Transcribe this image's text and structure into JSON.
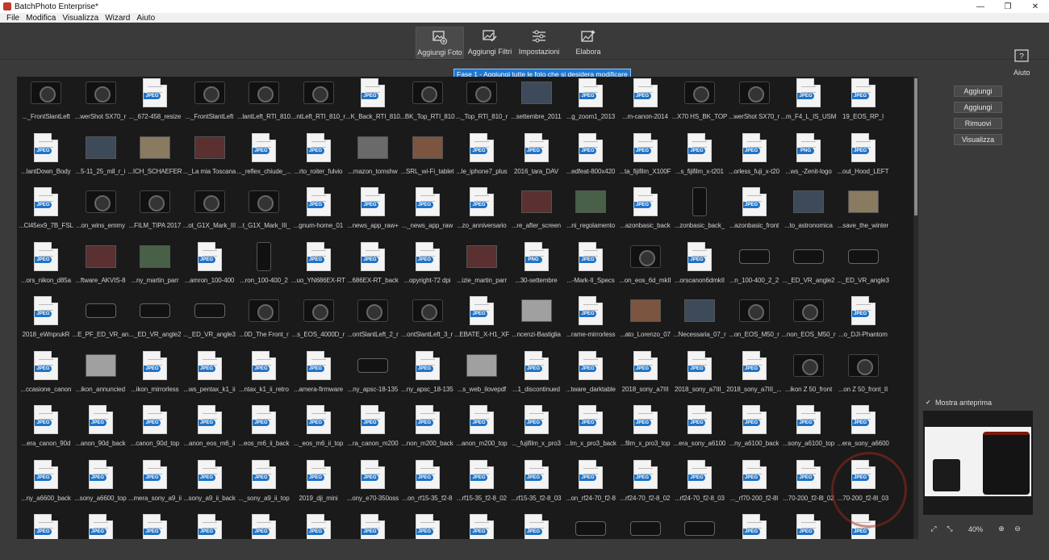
{
  "window": {
    "title": "BatchPhoto Enterprise*"
  },
  "menu": [
    "File",
    "Modifica",
    "Visualizza",
    "Wizard",
    "Aiuto"
  ],
  "toolbar": {
    "add_photos": "Aggiungi Foto",
    "add_filters": "Aggiungi Filtri",
    "settings": "Impostazioni",
    "process": "Elabora",
    "help": "Aiuto"
  },
  "tooltip": "Fase 1 - Aggiungi tutte le foto che si desidera modificare",
  "side_buttons": [
    "Aggiungi",
    "Aggiungi",
    "Rimuovi",
    "Visualizza"
  ],
  "preview": {
    "label": "Mostra anteprima",
    "zoom": "40%"
  },
  "colors": {
    "accent": "#1f73c7",
    "tooltip": "#1e78d2",
    "panel": "#1a1a1a"
  },
  "grid": [
    [
      {
        "k": "cam",
        "c": "..._FrontSlantLeft"
      },
      {
        "k": "cam",
        "c": "...werShot SX70_r"
      },
      {
        "k": "file",
        "t": "JPEG",
        "c": "..._672-458_resize"
      },
      {
        "k": "cam",
        "c": "..._FrontSlantLeft"
      },
      {
        "k": "cam",
        "c": "...lantLeft_RTI_810"
      },
      {
        "k": "cam",
        "c": "...ntLeft_RTI_810_r"
      },
      {
        "k": "file",
        "t": "JPEG",
        "c": "...K_Back_RTI_810"
      },
      {
        "k": "cam",
        "c": "...BK_Top_RTI_810"
      },
      {
        "k": "cam",
        "c": "..._Top_RTI_810_r"
      },
      {
        "k": "photo",
        "c": "...settembre_2011"
      },
      {
        "k": "file",
        "t": "JPEG",
        "c": "...g_zoom1_2013"
      },
      {
        "k": "file",
        "t": "JPEG",
        "c": "...m-canon-2014"
      },
      {
        "k": "cam",
        "c": "...X70 HS_BK_TOP"
      },
      {
        "k": "cam",
        "c": "...werShot SX70_r"
      },
      {
        "k": "file",
        "t": "JPEG",
        "c": "...m_F4_L_IS_USM"
      },
      {
        "k": "file",
        "t": "JPEG",
        "c": "19_EOS_RP_l"
      }
    ],
    [
      {
        "k": "file",
        "t": "JPEG",
        "c": "...lantDown_Body"
      },
      {
        "k": "photo",
        "c": "...5-11_25_mll_r_i"
      },
      {
        "k": "photo",
        "c": "...ICH_SCHAEFER"
      },
      {
        "k": "photo",
        "c": "..._La mia Toscana"
      },
      {
        "k": "file",
        "t": "JPEG",
        "c": "..._reflex_chiude_..."
      },
      {
        "k": "file",
        "t": "JPEG",
        "c": "...rto_roiter_fulvio"
      },
      {
        "k": "photo",
        "c": "...mazon_tomshw"
      },
      {
        "k": "photo",
        "c": "...SRL_wi-Fi_tablet"
      },
      {
        "k": "file",
        "t": "JPEG",
        "c": "...le_iphone7_plus"
      },
      {
        "k": "file",
        "t": "JPEG",
        "c": "2016_tara_DAV"
      },
      {
        "k": "file",
        "t": "JPEG",
        "c": "...edfeat-800x420"
      },
      {
        "k": "file",
        "t": "JPEG",
        "c": "...ta_fijifilm_X100F"
      },
      {
        "k": "file",
        "t": "JPEG",
        "c": "...s_fijifilm_x-t201"
      },
      {
        "k": "file",
        "t": "JPEG",
        "c": "...orless_fuji_x-t20"
      },
      {
        "k": "file",
        "t": "PNG",
        "c": "...ws_-Zenit-logo"
      },
      {
        "k": "file",
        "t": "JPEG",
        "c": "...out_Hood_LEFT"
      }
    ],
    [
      {
        "k": "file",
        "t": "JPEG",
        "c": "...Cl45ex9_7B_FSL"
      },
      {
        "k": "cam",
        "c": "...on_wins_emmy"
      },
      {
        "k": "cam",
        "c": "...FILM_TIPA 2017"
      },
      {
        "k": "cam",
        "c": "...ot_G1X_Mark_III"
      },
      {
        "k": "cam",
        "c": "...t_G1X_Mark_III_"
      },
      {
        "k": "file",
        "t": "JPEG",
        "c": "...gnum-home_01"
      },
      {
        "k": "file",
        "t": "JPEG",
        "c": "...news_app_raw+"
      },
      {
        "k": "file",
        "t": "JPEG",
        "c": "..._news_app_raw"
      },
      {
        "k": "file",
        "t": "JPEG",
        "c": "...zo_anniversario"
      },
      {
        "k": "photo",
        "c": "...re_after_screen"
      },
      {
        "k": "photo",
        "c": "...ni_regolamento"
      },
      {
        "k": "file",
        "t": "JPEG",
        "c": "...azonbasic_back"
      },
      {
        "k": "lens",
        "c": "...zonbasic_back_"
      },
      {
        "k": "file",
        "t": "JPEG",
        "c": "...azonbasic_front"
      },
      {
        "k": "photo",
        "c": "...to_astronomica"
      },
      {
        "k": "photo",
        "c": "...save_the_winter"
      }
    ],
    [
      {
        "k": "file",
        "t": "JPEG",
        "c": "...ors_nikon_d85a"
      },
      {
        "k": "photo",
        "c": "...ftware_AKVIS-8"
      },
      {
        "k": "photo",
        "c": "...ny_martin_parr"
      },
      {
        "k": "file",
        "t": "JPEG",
        "c": "...amron_100-400"
      },
      {
        "k": "lens",
        "c": "...ron_100-400_2"
      },
      {
        "k": "file",
        "t": "JPEG",
        "c": "...uo_YN686EX-RT"
      },
      {
        "k": "file",
        "t": "JPEG",
        "c": "...686EX-RT_back"
      },
      {
        "k": "file",
        "t": "JPEG",
        "c": "...opyright-72 dpi"
      },
      {
        "k": "photo",
        "c": "...izie_martin_parr"
      },
      {
        "k": "file",
        "t": "PNG",
        "c": "...30-settembre"
      },
      {
        "k": "file",
        "t": "JPEG",
        "c": "...-Mark-II_Specs"
      },
      {
        "k": "cam",
        "c": "...on_eos_6d_mkII"
      },
      {
        "k": "file",
        "t": "JPEG",
        "c": "...orscanon6dmkII"
      },
      {
        "k": "lensh",
        "c": "...n_100-400_2_2"
      },
      {
        "k": "lensh",
        "c": "..._ED_VR_angle2"
      },
      {
        "k": "lensh",
        "c": "..._ED_VR_angle3"
      }
    ],
    [
      {
        "k": "file",
        "t": "JPEG",
        "c": "2018_eWnprukR"
      },
      {
        "k": "lensh",
        "c": "...E_PF_ED_VR_an"
      },
      {
        "k": "lensh",
        "c": "..._ED_VR_angle2"
      },
      {
        "k": "lensh",
        "c": "..._ED_VR_angle3"
      },
      {
        "k": "cam",
        "c": "...0D_The Front_r"
      },
      {
        "k": "cam",
        "c": "...s_EOS_4000D_r"
      },
      {
        "k": "cam",
        "c": "...ontSlantLeft_2_r"
      },
      {
        "k": "cam",
        "c": "...ontSlantLeft_3_r"
      },
      {
        "k": "file",
        "t": "JPEG",
        "c": "...EBATE_X-H1_XF"
      },
      {
        "k": "photo",
        "c": "...ncenzi-Bastiglia"
      },
      {
        "k": "file",
        "t": "JPEG",
        "c": "...rame-mirrorless"
      },
      {
        "k": "photo",
        "c": "...ato_Lorenzo_07"
      },
      {
        "k": "photo",
        "c": "...Necessaria_07_r"
      },
      {
        "k": "cam",
        "c": "...on_EOS_M50_r"
      },
      {
        "k": "cam",
        "c": "...non_EOS_M50_r"
      },
      {
        "k": "file",
        "t": "JPEG",
        "c": "...o_DJI-Phantom"
      }
    ],
    [
      {
        "k": "file",
        "t": "JPEG",
        "c": "...ccasione_canon"
      },
      {
        "k": "photo",
        "c": "...ikon_annuncied"
      },
      {
        "k": "file",
        "t": "JPEG",
        "c": "...ikon_mirrorless"
      },
      {
        "k": "file",
        "t": "JPEG",
        "c": "...ws_pentax_k1_ii"
      },
      {
        "k": "file",
        "t": "JPEG",
        "c": "...ntax_k1_ii_retro"
      },
      {
        "k": "file",
        "t": "JPEG",
        "c": "...amera-firmware"
      },
      {
        "k": "lensh",
        "c": "...ny_apsc-18-135"
      },
      {
        "k": "file",
        "t": "JPEG",
        "c": "...ny_apsc_18-135"
      },
      {
        "k": "photo",
        "c": "...s_web_ilovepdf"
      },
      {
        "k": "file",
        "t": "JPEG",
        "c": "...1_discontinued"
      },
      {
        "k": "file",
        "t": "JPEG",
        "c": "...tware_darktable"
      },
      {
        "k": "file",
        "t": "JPEG",
        "c": "2018_sony_a7III"
      },
      {
        "k": "file",
        "t": "JPEG",
        "c": "2018_sony_a7III_"
      },
      {
        "k": "file",
        "t": "JPEG",
        "c": "2018_sony_a7III_..."
      },
      {
        "k": "cam",
        "c": "...ikon Z 50_front"
      },
      {
        "k": "cam",
        "c": "...on Z 50_front_II"
      }
    ],
    [
      {
        "k": "file",
        "t": "JPEG",
        "c": "...era_canon_90d"
      },
      {
        "k": "file",
        "t": "JPEG",
        "c": "...anon_90d_back"
      },
      {
        "k": "file",
        "t": "JPEG",
        "c": "...canon_90d_top"
      },
      {
        "k": "file",
        "t": "JPEG",
        "c": "...anon_eos_m6_ii"
      },
      {
        "k": "file",
        "t": "JPEG",
        "c": "...eos_m6_ii_back"
      },
      {
        "k": "file",
        "t": "JPEG",
        "c": "..._eos_m6_ii_top"
      },
      {
        "k": "file",
        "t": "JPEG",
        "c": "...ra_canon_m200"
      },
      {
        "k": "file",
        "t": "JPEG",
        "c": "...non_m200_back"
      },
      {
        "k": "file",
        "t": "JPEG",
        "c": "...anon_m200_top"
      },
      {
        "k": "file",
        "t": "JPEG",
        "c": "..._fujifilm_x_pro3"
      },
      {
        "k": "file",
        "t": "JPEG",
        "c": "...lm_x_pro3_back"
      },
      {
        "k": "file",
        "t": "JPEG",
        "c": "...film_x_pro3_top"
      },
      {
        "k": "file",
        "t": "JPEG",
        "c": "...era_sony_a6100"
      },
      {
        "k": "file",
        "t": "JPEG",
        "c": "...ny_a6100_back"
      },
      {
        "k": "file",
        "t": "JPEG",
        "c": "...sony_a6100_top"
      },
      {
        "k": "file",
        "t": "JPEG",
        "c": "...era_sony_a6600"
      }
    ],
    [
      {
        "k": "file",
        "t": "JPEG",
        "c": "...ny_a6600_back"
      },
      {
        "k": "file",
        "t": "JPEG",
        "c": "...sony_a6600_top"
      },
      {
        "k": "file",
        "t": "JPEG",
        "c": "...mera_sony_a9_ii"
      },
      {
        "k": "file",
        "t": "JPEG",
        "c": "...sony_a9_ii_back"
      },
      {
        "k": "file",
        "t": "JPEG",
        "c": "..._sony_a9_ii_top"
      },
      {
        "k": "file",
        "t": "JPEG",
        "c": "2019_dji_mini"
      },
      {
        "k": "file",
        "t": "JPEG",
        "c": "...ony_e70-350oss"
      },
      {
        "k": "file",
        "t": "JPEG",
        "c": "...on_rf15-35_f2-8"
      },
      {
        "k": "file",
        "t": "JPEG",
        "c": "...rf15-35_f2-8_02"
      },
      {
        "k": "file",
        "t": "JPEG",
        "c": "...rf15-35_f2-8_03"
      },
      {
        "k": "file",
        "t": "JPEG",
        "c": "...on_rf24-70_f2-8"
      },
      {
        "k": "file",
        "t": "JPEG",
        "c": "...rf24-70_f2-8_02"
      },
      {
        "k": "file",
        "t": "JPEG",
        "c": "...rf24-70_f2-8_03"
      },
      {
        "k": "file",
        "t": "JPEG",
        "c": "..._rf70-200_f2-8l"
      },
      {
        "k": "file",
        "t": "JPEG",
        "c": "...70-200_f2-8l_02"
      },
      {
        "k": "file",
        "t": "JPEG",
        "c": "...70-200_f2-8l_03"
      }
    ],
    [
      {
        "k": "file",
        "t": "JPEG",
        "c": ""
      },
      {
        "k": "file",
        "t": "JPEG",
        "c": ""
      },
      {
        "k": "file",
        "t": "JPEG",
        "c": ""
      },
      {
        "k": "file",
        "t": "JPEG",
        "c": ""
      },
      {
        "k": "file",
        "t": "JPEG",
        "c": ""
      },
      {
        "k": "file",
        "t": "JPEG",
        "c": ""
      },
      {
        "k": "file",
        "t": "JPEG",
        "c": ""
      },
      {
        "k": "file",
        "t": "JPEG",
        "c": ""
      },
      {
        "k": "file",
        "t": "JPEG",
        "c": ""
      },
      {
        "k": "file",
        "t": "JPEG",
        "c": ""
      },
      {
        "k": "lensh",
        "c": ""
      },
      {
        "k": "lensh",
        "c": ""
      },
      {
        "k": "lensh",
        "c": ""
      },
      {
        "k": "file",
        "t": "JPEG",
        "c": ""
      },
      {
        "k": "file",
        "t": "JPEG",
        "c": ""
      },
      {
        "k": "file",
        "t": "JPEG",
        "c": ""
      }
    ]
  ]
}
